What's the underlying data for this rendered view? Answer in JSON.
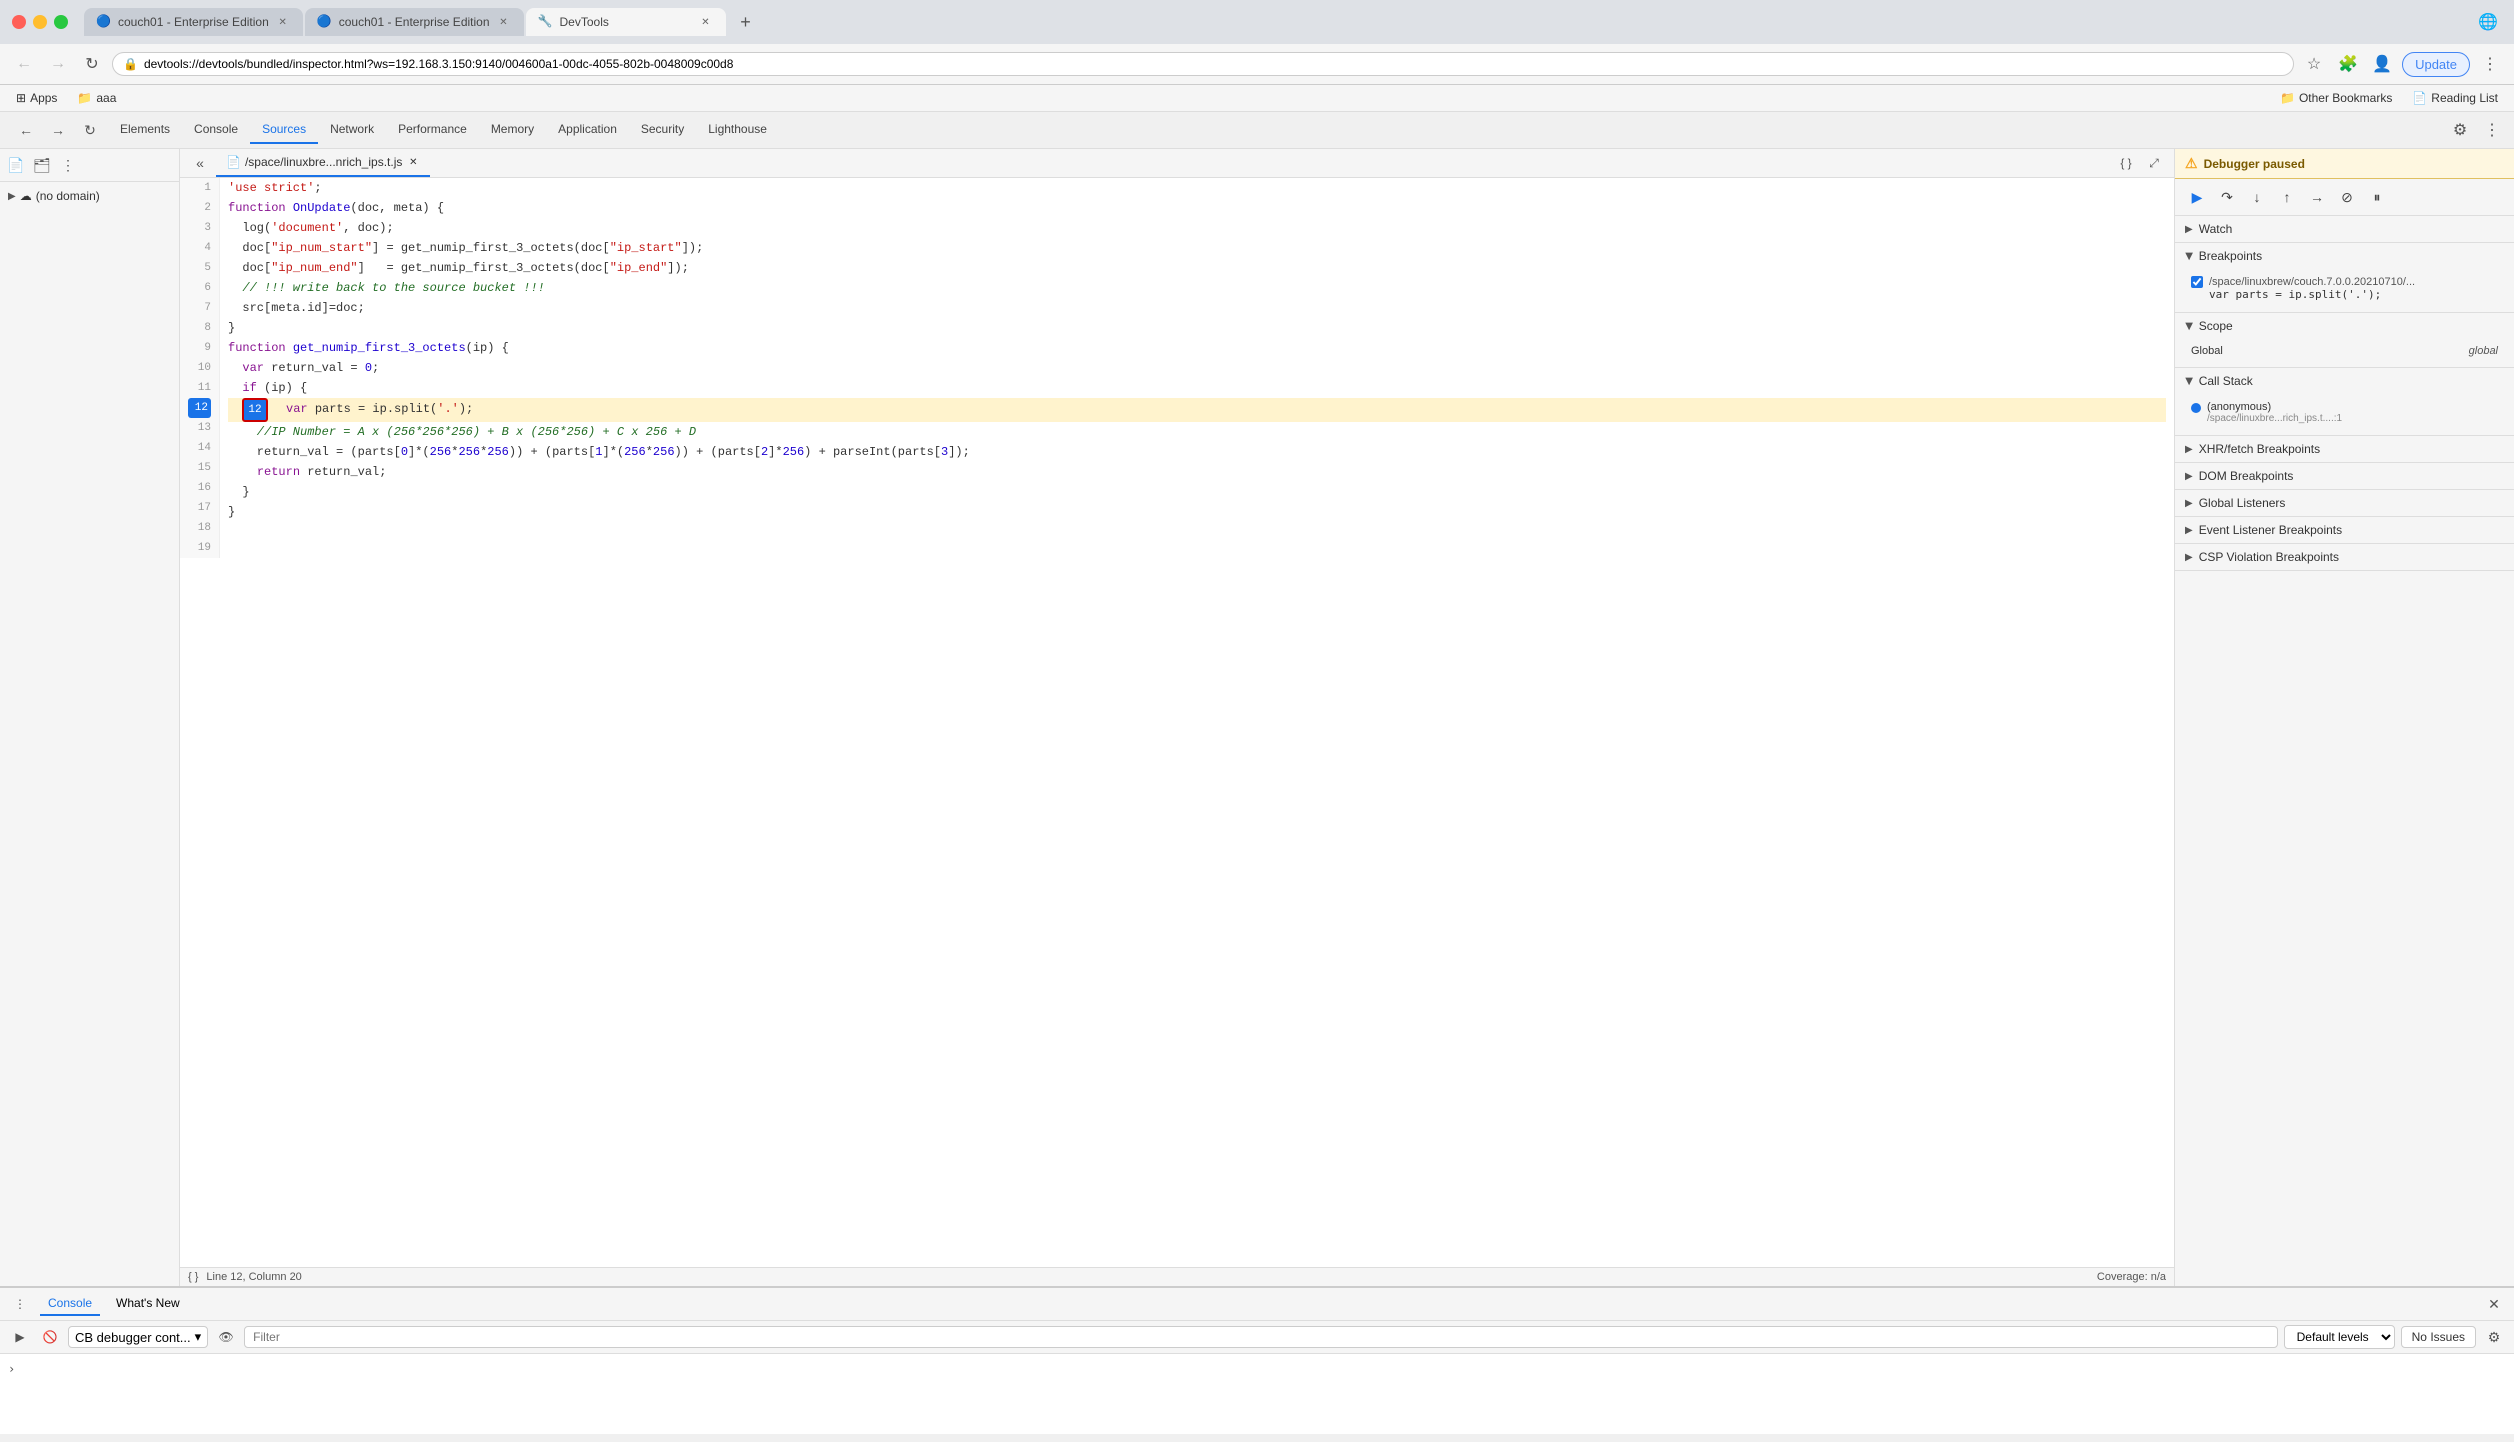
{
  "browser": {
    "tabs": [
      {
        "id": "tab1",
        "title": "couch01 - Enterprise Edition",
        "favicon": "🔵",
        "active": false
      },
      {
        "id": "tab2",
        "title": "couch01 - Enterprise Edition",
        "favicon": "🔵",
        "active": false
      },
      {
        "id": "tab3",
        "title": "DevTools",
        "favicon": "🔧",
        "active": true
      }
    ],
    "address": "devtools://devtools/bundled/inspector.html?ws=192.168.3.150:9140/004600a1-00dc-4055-802b-0048009c00d8",
    "update_label": "Update"
  },
  "bookmarks": {
    "items": [
      {
        "label": "Apps",
        "icon": "⊞"
      },
      {
        "label": "aaa",
        "icon": "📁"
      }
    ],
    "right": [
      {
        "label": "Other Bookmarks",
        "icon": "📁"
      },
      {
        "label": "Reading List",
        "icon": "📄"
      }
    ]
  },
  "devtools": {
    "nav_items": [
      {
        "label": "Elements",
        "active": false
      },
      {
        "label": "Console",
        "active": false
      },
      {
        "label": "Sources",
        "active": true
      },
      {
        "label": "Network",
        "active": false
      },
      {
        "label": "Performance",
        "active": false
      },
      {
        "label": "Memory",
        "active": false
      },
      {
        "label": "Application",
        "active": false
      },
      {
        "label": "Security",
        "active": false
      },
      {
        "label": "Lighthouse",
        "active": false
      }
    ],
    "file_path": "/space/linuxbre...nrich_ips.t.js",
    "left_panel": {
      "domain": "(no domain)"
    },
    "code": {
      "lines": [
        {
          "num": 1,
          "text": "'use strict';",
          "active": false
        },
        {
          "num": 2,
          "text": "function OnUpdate(doc, meta) {",
          "active": false
        },
        {
          "num": 3,
          "text": "  log('document', doc);",
          "active": false
        },
        {
          "num": 4,
          "text": "  doc[\"ip_num_start\"] = get_numip_first_3_octets(doc[\"ip_start\"]);",
          "active": false
        },
        {
          "num": 5,
          "text": "  doc[\"ip_num_end\"]   = get_numip_first_3_octets(doc[\"ip_end\"]);",
          "active": false
        },
        {
          "num": 6,
          "text": "  // !!! write back to the source bucket !!!",
          "active": false
        },
        {
          "num": 7,
          "text": "  src[meta.id]=doc;",
          "active": false
        },
        {
          "num": 8,
          "text": "}",
          "active": false
        },
        {
          "num": 9,
          "text": "function get_numip_first_3_octets(ip) {",
          "active": false
        },
        {
          "num": 10,
          "text": "  var return_val = 0;",
          "active": false
        },
        {
          "num": 11,
          "text": "  if (ip) {",
          "active": false
        },
        {
          "num": 12,
          "text": "    var parts = ip.split('.');",
          "active": true,
          "breakpoint": true
        },
        {
          "num": 13,
          "text": "    //IP Number = A x (256*256*256) + B x (256*256) + C x 256 + D",
          "active": false
        },
        {
          "num": 14,
          "text": "    return_val = (parts[0]*(256*256*256)) + (parts[1]*(256*256)) + (parts[2]*256) + parseInt(parts[3]);",
          "active": false
        },
        {
          "num": 15,
          "text": "    return return_val;",
          "active": false
        },
        {
          "num": 16,
          "text": "  }",
          "active": false
        },
        {
          "num": 17,
          "text": "}",
          "active": false
        },
        {
          "num": 18,
          "text": "",
          "active": false
        },
        {
          "num": 19,
          "text": "",
          "active": false
        }
      ],
      "status": "Line 12, Column 20",
      "coverage": "Coverage: n/a"
    },
    "debugger": {
      "paused_label": "Debugger paused",
      "sections": [
        {
          "id": "watch",
          "label": "Watch",
          "open": false
        },
        {
          "id": "breakpoints",
          "label": "Breakpoints",
          "open": true
        },
        {
          "id": "scope",
          "label": "Scope",
          "open": true
        },
        {
          "id": "callstack",
          "label": "Call Stack",
          "open": true
        },
        {
          "id": "xhr",
          "label": "XHR/fetch Breakpoints",
          "open": false
        },
        {
          "id": "dom",
          "label": "DOM Breakpoints",
          "open": false
        },
        {
          "id": "global",
          "label": "Global Listeners",
          "open": false
        },
        {
          "id": "eventlistener",
          "label": "Event Listener Breakpoints",
          "open": false
        },
        {
          "id": "csp",
          "label": "CSP Violation Breakpoints",
          "open": false
        }
      ],
      "breakpoint": {
        "file": "/space/linuxbrew/couch.7.0.0.20210710/...",
        "code": "var parts = ip.split('.');"
      },
      "scope": {
        "label": "Global",
        "value": "global"
      },
      "callstack": {
        "fn": "(anonymous)",
        "location": "/space/linuxbre...rich_ips.t....:1"
      }
    },
    "console": {
      "tabs": [
        {
          "label": "Console",
          "active": true
        },
        {
          "label": "What's New",
          "active": false
        }
      ],
      "context": "CB debugger cont...",
      "filter_placeholder": "Filter",
      "levels": "Default levels",
      "no_issues": "No Issues"
    }
  }
}
